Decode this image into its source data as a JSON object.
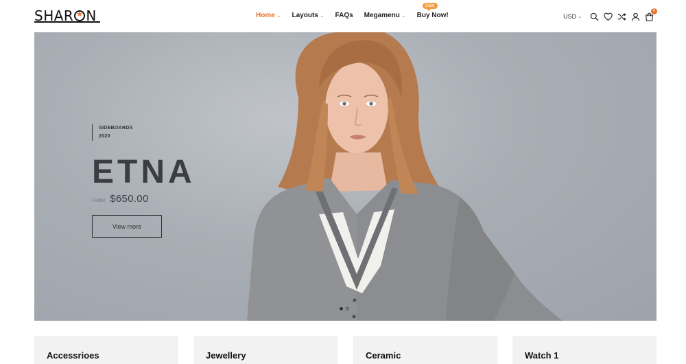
{
  "brand": {
    "logo_text_left": "SHAR",
    "logo_text_right": "N"
  },
  "nav": {
    "items": [
      {
        "label": "Home",
        "has_caret": true,
        "active": true
      },
      {
        "label": "Layouts",
        "has_caret": true,
        "active": false
      },
      {
        "label": "FAQs",
        "has_caret": false,
        "active": false
      },
      {
        "label": "Megamenu",
        "has_caret": true,
        "active": false
      },
      {
        "label": "Buy Now!",
        "has_caret": false,
        "active": false,
        "badge": "Sale"
      }
    ],
    "caret_glyph": "⌄"
  },
  "tools": {
    "currency": "USD",
    "cart_count": "0",
    "icons": [
      "search-icon",
      "heart-icon",
      "shuffle-icon",
      "user-icon",
      "cart-icon"
    ]
  },
  "hero": {
    "eyebrow_line1": "SIDEBOARDS",
    "eyebrow_line2": "2020",
    "title": "ETNA",
    "price_prefix": "FROM",
    "price": "$650.00",
    "cta_label": "View more",
    "slides_total": 2,
    "slide_active": 1
  },
  "categories": [
    {
      "title": "Accessrioes"
    },
    {
      "title": "Jewellery"
    },
    {
      "title": "Ceramic"
    },
    {
      "title": "Watch 1"
    }
  ],
  "colors": {
    "accent": "#e8702a",
    "badge": "#f19a3e",
    "hero_bg": "#a9aeb6",
    "card_bg": "#f2f2f2",
    "text_dark": "#3b3d44"
  }
}
